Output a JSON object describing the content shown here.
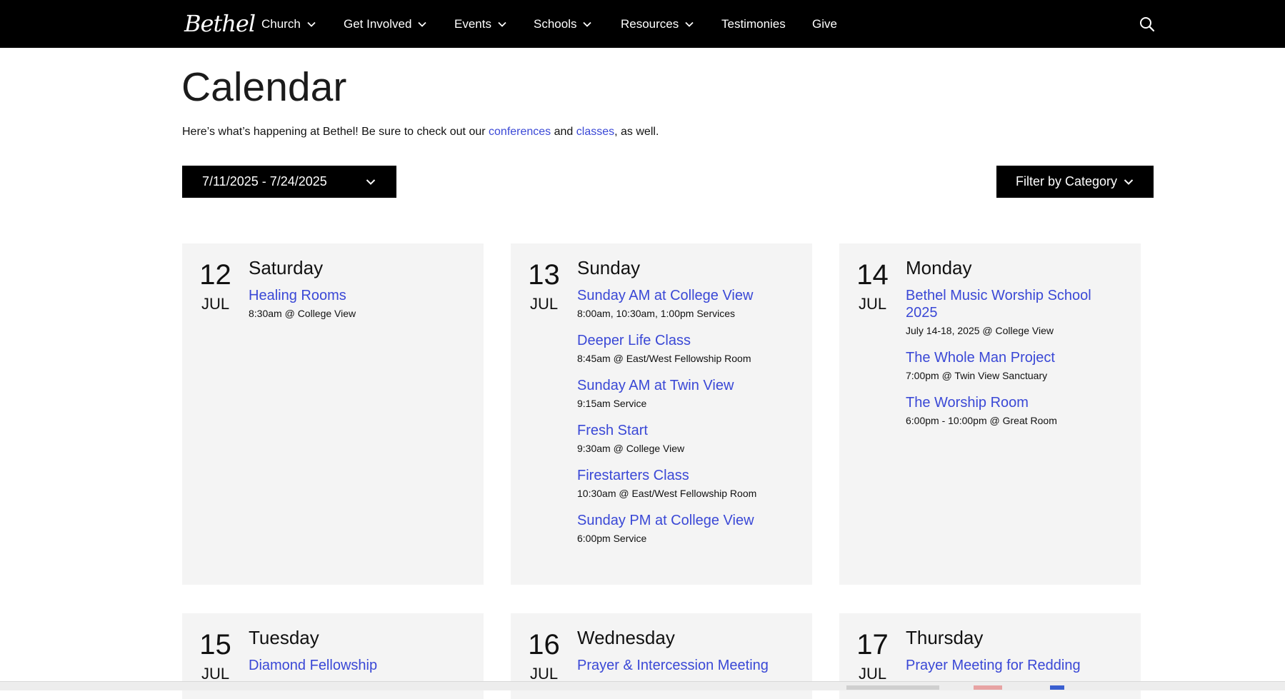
{
  "nav": {
    "logo_text": "Bethel",
    "items": [
      {
        "label": "Church",
        "has_dropdown": true
      },
      {
        "label": "Get Involved",
        "has_dropdown": true
      },
      {
        "label": "Events",
        "has_dropdown": true
      },
      {
        "label": "Schools",
        "has_dropdown": true
      },
      {
        "label": "Resources",
        "has_dropdown": true
      },
      {
        "label": "Testimonies",
        "has_dropdown": false
      },
      {
        "label": "Give",
        "has_dropdown": false
      }
    ],
    "search_icon": "search-icon"
  },
  "page": {
    "title": "Calendar",
    "intro": {
      "before": "Here’s what’s happening at Bethel! Be sure to check out our ",
      "link1": "conferences",
      "middle": " and ",
      "link2": "classes",
      "after": ", as well."
    }
  },
  "controls": {
    "date_range": "7/11/2025 - 7/24/2025",
    "filter_label": "Filter by Category"
  },
  "days": [
    {
      "num": "12",
      "month": "JUL",
      "weekday": "Saturday",
      "events": [
        {
          "title": "Healing Rooms",
          "detail": "8:30am @ College View"
        }
      ]
    },
    {
      "num": "13",
      "month": "JUL",
      "weekday": "Sunday",
      "events": [
        {
          "title": "Sunday AM at College View",
          "detail": "8:00am, 10:30am, 1:00pm Services"
        },
        {
          "title": "Deeper Life Class",
          "detail": "8:45am @ East/West Fellowship Room"
        },
        {
          "title": "Sunday AM at Twin View",
          "detail": "9:15am Service"
        },
        {
          "title": "Fresh Start",
          "detail": "9:30am @ College View"
        },
        {
          "title": "Firestarters Class",
          "detail": "10:30am @ East/West Fellowship Room"
        },
        {
          "title": "Sunday PM at College View",
          "detail": "6:00pm Service"
        }
      ]
    },
    {
      "num": "14",
      "month": "JUL",
      "weekday": "Monday",
      "events": [
        {
          "title": "Bethel Music Worship School 2025",
          "detail": "July 14-18, 2025 @ College View"
        },
        {
          "title": "The Whole Man Project",
          "detail": "7:00pm @ Twin View Sanctuary"
        },
        {
          "title": "The Worship Room",
          "detail": "6:00pm - 10:00pm @ Great Room"
        }
      ]
    },
    {
      "num": "15",
      "month": "JUL",
      "weekday": "Tuesday",
      "events": [
        {
          "title": "Diamond Fellowship"
        }
      ]
    },
    {
      "num": "16",
      "month": "JUL",
      "weekday": "Wednesday",
      "events": [
        {
          "title": "Prayer & Intercession Meeting"
        }
      ]
    },
    {
      "num": "17",
      "month": "JUL",
      "weekday": "Thursday",
      "events": [
        {
          "title": "Prayer Meeting for Redding"
        }
      ]
    }
  ],
  "colors": {
    "nav_bg": "#000000",
    "link": "#3a48d6",
    "card_bg": "#f4f4f4",
    "button_bg": "#000000"
  }
}
